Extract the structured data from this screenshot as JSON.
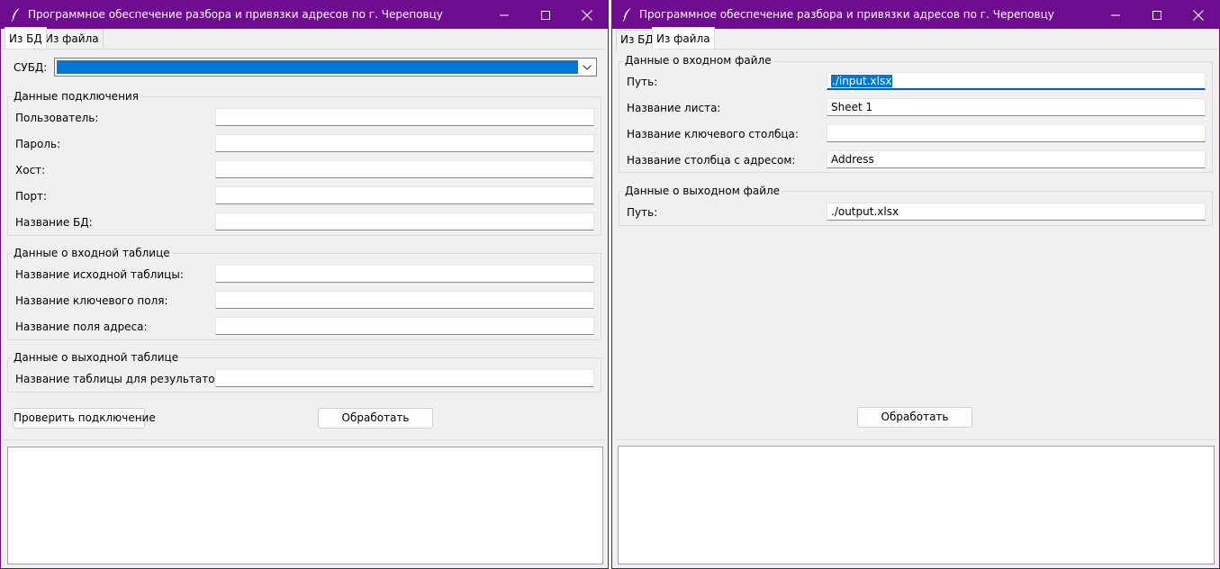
{
  "window_title": "Программное обеспечение разбора и привязки адресов по г. Череповцу",
  "window_controls": {
    "minimize": "minimize-icon",
    "maximize": "maximize-icon",
    "close": "close-icon"
  },
  "tabs": {
    "db": "Из БД",
    "file": "Из файла"
  },
  "db_tab": {
    "dbms_label": "СУБД:",
    "dbms_value": "",
    "connection_group": "Данные подключения",
    "fields": {
      "user": {
        "label": "Пользователь:",
        "value": ""
      },
      "password": {
        "label": "Пароль:",
        "value": ""
      },
      "host": {
        "label": "Хост:",
        "value": ""
      },
      "port": {
        "label": "Порт:",
        "value": ""
      },
      "dbname": {
        "label": "Название БД:",
        "value": ""
      }
    },
    "input_table_group": "Данные о входной таблице",
    "input_table": {
      "source_table": {
        "label": "Название исходной таблицы:",
        "value": ""
      },
      "key_field": {
        "label": "Название ключевого поля:",
        "value": ""
      },
      "address_field": {
        "label": "Название поля адреса:",
        "value": ""
      }
    },
    "output_table_group": "Данные о выходной таблице",
    "output_table": {
      "result_table": {
        "label": "Название таблицы для результатов:",
        "value": ""
      }
    },
    "check_button": "Проверить подключение",
    "process_button": "Обработать"
  },
  "file_tab": {
    "input_group": "Данные о входном файле",
    "input": {
      "path": {
        "label": "Путь:",
        "value": "./input.xlsx"
      },
      "sheet": {
        "label": "Название листа:",
        "value": "Sheet 1"
      },
      "key_column": {
        "label": "Название ключевого столбца:",
        "value": ""
      },
      "address_column": {
        "label": "Название столбца с адресом:",
        "value": "Address"
      }
    },
    "output_group": "Данные о выходном файле",
    "output": {
      "path": {
        "label": "Путь:",
        "value": "./output.xlsx"
      }
    },
    "process_button": "Обработать"
  },
  "colors": {
    "titlebar": "#6e0c8f",
    "selection": "#0078d7",
    "window_bg": "#f0f0f0",
    "focus_underline": "#005fb8"
  }
}
